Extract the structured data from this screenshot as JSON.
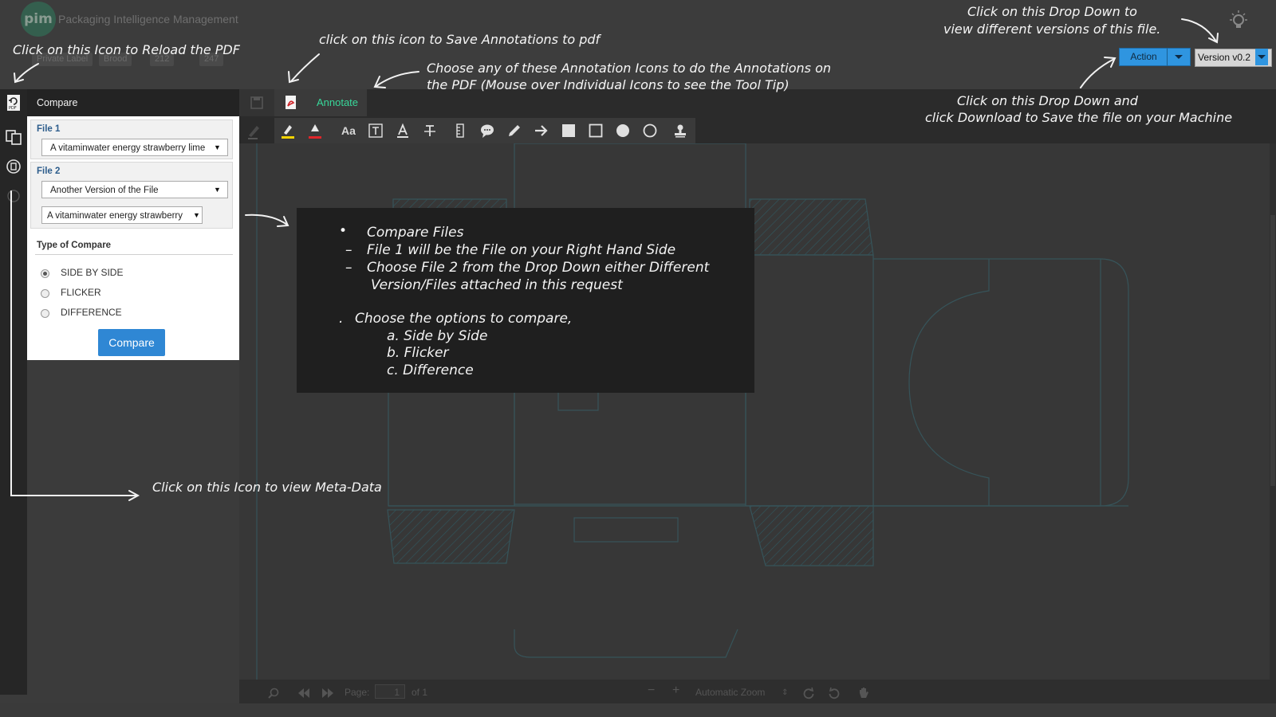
{
  "header": {
    "logo_text": "pim",
    "app_title": "Packaging Intelligence Management"
  },
  "crumbs": [
    "Private Label",
    "Brood",
    "212",
    "247"
  ],
  "actions": {
    "action_label": "Action",
    "version_label": "Version v0.2"
  },
  "viewer": {
    "tab_annotate": "Annotate",
    "page_label": "Page:",
    "page_current": "1",
    "page_total": "of 1",
    "zoom_label": "Automatic Zoom"
  },
  "compare_panel": {
    "title": "Compare",
    "file1_label": "File 1",
    "file1_value": "A vitaminwater energy strawberry lime",
    "file2_label": "File 2",
    "file2_type": "Another Version of the File",
    "file2_value": "A vitaminwater energy strawberry",
    "type_label": "Type of Compare",
    "options": [
      "SIDE BY SIDE",
      "FLICKER",
      "DIFFERENCE"
    ],
    "selected": "SIDE BY SIDE",
    "button": "Compare"
  },
  "callouts": {
    "reload": "Click on this Icon to Reload the PDF",
    "save": "click on this icon to Save Annotations to pdf",
    "annotate_line1": "Choose any of these Annotation Icons to do the Annotations on",
    "annotate_line2": "the PDF (Mouse over Individual Icons to see the Tool Tip)",
    "versions_line1": "Click on this Drop Down to",
    "versions_line2": "view different versions of this file.",
    "download_line1": "Click on this Drop Down and",
    "download_line2": "click Download to Save the file on your Machine",
    "metadata": "Click on this Icon to view Meta-Data"
  },
  "instructions": {
    "bullet": "Compare Files",
    "dash1": "File 1 will be the File on your Right Hand Side",
    "dash2": "Choose File 2 from the Drop Down either Different",
    "dash2b": "Version/Files attached in this request",
    "options_head": "Choose the options to compare,",
    "opt_a": "a. Side by Side",
    "opt_b": "b. Flicker",
    "opt_c": "c. Difference"
  },
  "colors": {
    "accent_green": "#38d89a",
    "button_blue": "#2f87d4",
    "action_blue": "#2f95e0"
  }
}
